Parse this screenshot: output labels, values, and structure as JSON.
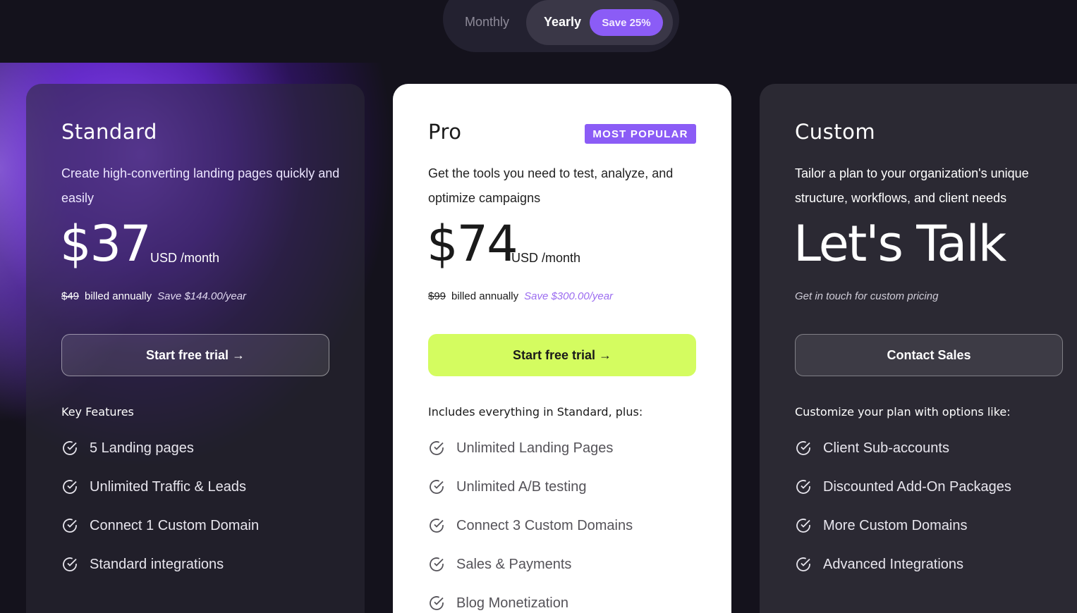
{
  "billing_toggle": {
    "monthly_label": "Monthly",
    "yearly_label": "Yearly",
    "save_badge": "Save 25%",
    "selected": "Yearly"
  },
  "plans": [
    {
      "name": "Standard",
      "description": "Create high-converting landing pages quickly and easily",
      "price": "$37",
      "price_unit": "USD /month",
      "original_price": "$49",
      "billing_note": "billed annually",
      "savings": "Save $144.00/year",
      "cta": "Start free trial →",
      "features_title": "Key Features",
      "features": [
        "5 Landing pages",
        "Unlimited Traffic & Leads",
        "Connect 1 Custom Domain",
        "Standard integrations"
      ]
    },
    {
      "name": "Pro",
      "badge": "MOST POPULAR",
      "description": "Get the tools you need to test, analyze, and optimize campaigns",
      "price": "$74",
      "price_unit": "USD /month",
      "original_price": "$99",
      "billing_note": "billed annually",
      "savings": "Save $300.00/year",
      "cta": "Start free trial →",
      "features_title": "Includes everything in Standard, plus:",
      "features": [
        "Unlimited Landing Pages",
        "Unlimited A/B testing",
        "Connect 3 Custom Domains",
        "Sales & Payments",
        "Blog Monetization"
      ]
    },
    {
      "name": "Custom",
      "description": "Tailor a plan to your organization's unique structure, workflows, and client needs",
      "price": "Let's Talk",
      "billing_note": "Get in touch for custom pricing",
      "cta": "Contact Sales",
      "features_title": "Customize your plan with options like:",
      "features": [
        "Client Sub-accounts",
        "Discounted Add-On Packages",
        "More Custom Domains",
        "Advanced Integrations"
      ]
    }
  ],
  "colors": {
    "background": "#14121c",
    "accent_purple": "#8b5cf6",
    "pro_cta": "#d4fc60",
    "pro_badge": "#8b5cf6"
  }
}
